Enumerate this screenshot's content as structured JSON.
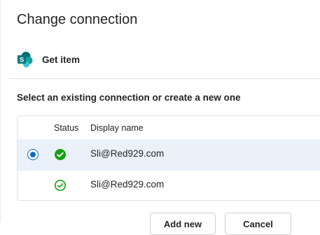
{
  "page": {
    "title": "Change connection"
  },
  "action": {
    "label": "Get item",
    "icon": "sharepoint-icon"
  },
  "section": {
    "heading": "Select an existing connection or create a new one"
  },
  "table": {
    "columns": {
      "status": "Status",
      "display_name": "Display name"
    },
    "rows": [
      {
        "selected": true,
        "status_icon": "check-circle-filled-icon",
        "display_name": "Sli@Red929.com"
      },
      {
        "selected": false,
        "status_icon": "check-circle-outline-icon",
        "display_name": "Sli@Red929.com"
      }
    ]
  },
  "buttons": {
    "add_new": "Add new",
    "cancel": "Cancel"
  },
  "colors": {
    "accent": "#0f6cbd",
    "success": "#13a10e",
    "selected_row": "#eaf1fb",
    "sharepoint_teal": "#038387"
  }
}
